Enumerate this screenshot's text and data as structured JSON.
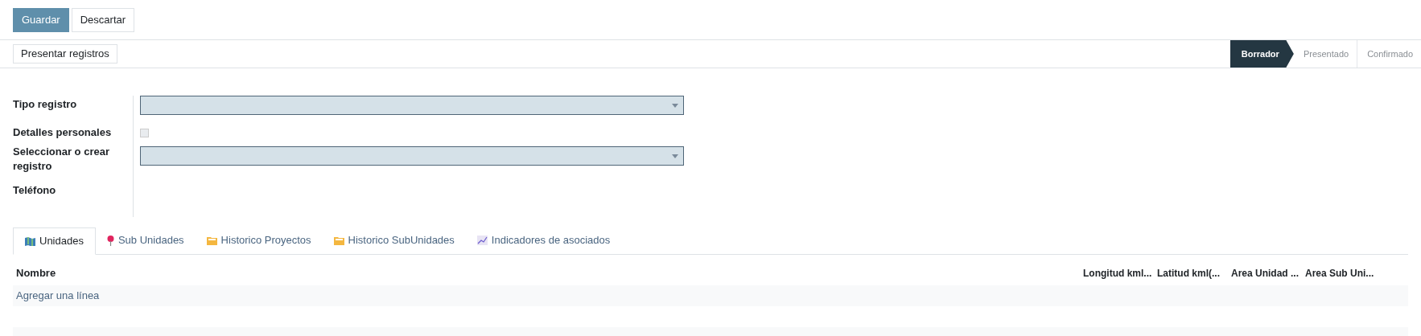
{
  "buttons": [
    {
      "label": "Guardar",
      "kind": "primary"
    },
    {
      "label": "Descartar",
      "kind": "secondary"
    }
  ],
  "action_button": "Presentar registros",
  "status_steps": [
    {
      "label": "Borrador",
      "selected": true
    },
    {
      "label": "Presentado",
      "selected": false
    },
    {
      "label": "Confirmado",
      "selected": false
    }
  ],
  "fields": [
    {
      "label": "Tipo registro",
      "kind": "select"
    },
    {
      "label": "Detalles personales",
      "kind": "checkbox",
      "checked": false
    },
    {
      "label": "Seleccionar o crear registro",
      "kind": "select"
    },
    {
      "label": "Teléfono",
      "kind": "empty"
    }
  ],
  "tabs": [
    {
      "label": "Unidades",
      "selected": true
    },
    {
      "label": "Sub Unidades",
      "selected": false
    },
    {
      "label": "Historico Proyectos",
      "selected": false
    },
    {
      "label": "Historico SubUnidades",
      "selected": false
    },
    {
      "label": "Indicadores de asociados",
      "selected": false
    }
  ],
  "table": {
    "columns": [
      "Nombre",
      "Longitud kml...",
      "Latitud kml(...",
      "Area Unidad ...",
      "Area Sub Uni..."
    ],
    "add_line": "Agregar una línea"
  }
}
